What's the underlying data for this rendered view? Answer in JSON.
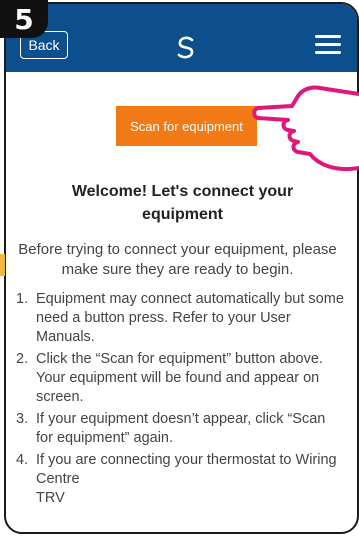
{
  "step_badge": "5",
  "navbar": {
    "back_label": "Back",
    "logo_icon": "salus-logo-icon",
    "menu_icon": "hamburger-menu-icon",
    "background": "#0d4f8c"
  },
  "main": {
    "scan_button_label": "Scan for equipment",
    "scan_button_color": "#f27a16",
    "welcome_line1": "Welcome! Let's connect your",
    "welcome_line2": "equipment",
    "intro": "Before trying to connect your equipment, please make sure they are ready to begin.",
    "steps": [
      {
        "num": "1.",
        "text": "Equipment may connect automatically but some need a button press. Refer to your User Manuals."
      },
      {
        "num": "2.",
        "text": "Click the “Scan for equipment” button above. Your equipment will be found and appear on screen."
      },
      {
        "num": "3.",
        "text": "If your equipment doesn’t appear, click “Scan for equipment” again."
      },
      {
        "num": "4.",
        "text": "If you are connecting your thermostat to Wiring Centre",
        "extra": "TRV"
      }
    ]
  },
  "overlay": {
    "pointer_icon": "pointing-hand-icon",
    "pointer_color": "#e0177a"
  }
}
